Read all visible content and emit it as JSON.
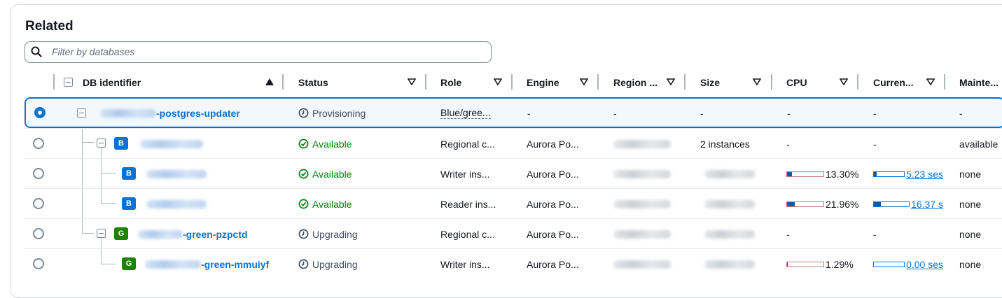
{
  "panel": {
    "title": "Related",
    "filter_placeholder": "Filter by databases"
  },
  "columns": [
    {
      "label": "DB identifier",
      "sort": "asc"
    },
    {
      "label": "Status"
    },
    {
      "label": "Role"
    },
    {
      "label": "Engine"
    },
    {
      "label": "Region ..."
    },
    {
      "label": "Size"
    },
    {
      "label": "CPU"
    },
    {
      "label": "Curren..."
    },
    {
      "label": "Mainte..."
    }
  ],
  "rows": [
    {
      "selected": true,
      "id_suffix": "-postgres-updater",
      "badge": "",
      "status": "Provisioning",
      "status_kind": "pending",
      "role": "Blue/gree...",
      "engine": "-",
      "region": "-",
      "size": "-",
      "cpu": "-",
      "conn": "-",
      "maint": "-"
    },
    {
      "selected": false,
      "id_suffix": "",
      "badge": "B",
      "status": "Available",
      "status_kind": "ok",
      "role": "Regional c...",
      "engine": "Aurora Po...",
      "region": "",
      "size": "2 instances",
      "cpu": "-",
      "conn": "-",
      "maint": "available"
    },
    {
      "selected": false,
      "id_suffix": "",
      "badge": "B",
      "status": "Available",
      "status_kind": "ok",
      "role": "Writer ins...",
      "engine": "Aurora Po...",
      "region": "",
      "size": "",
      "cpu_value": "13.30%",
      "cpu_fraction": 0.133,
      "conn_value": "5.23 ses",
      "conn_fraction": 0.1,
      "maint": "none"
    },
    {
      "selected": false,
      "id_suffix": "",
      "badge": "B",
      "status": "Available",
      "status_kind": "ok",
      "role": "Reader ins...",
      "engine": "Aurora Po...",
      "region": "",
      "size": "",
      "cpu_value": "21.96%",
      "cpu_fraction": 0.22,
      "conn_value": "16.37 s",
      "conn_fraction": 0.2,
      "maint": "none"
    },
    {
      "selected": false,
      "id_suffix": "-green-pzpctd",
      "badge": "G",
      "status": "Upgrading",
      "status_kind": "pending",
      "role": "Regional c...",
      "engine": "Aurora Po...",
      "region": "",
      "size": "",
      "cpu": "-",
      "conn": "-",
      "maint": "none"
    },
    {
      "selected": false,
      "id_suffix": "-green-mmuiyf",
      "badge": "G",
      "status": "Upgrading",
      "status_kind": "pending",
      "role": "Writer ins...",
      "engine": "Aurora Po...",
      "region": "",
      "size": "",
      "cpu_value": "1.29%",
      "cpu_fraction": 0.013,
      "conn_value": "0.00 ses",
      "conn_fraction": 0.0,
      "maint": "none"
    }
  ],
  "icons": {
    "search": "search-icon",
    "sort_asc": "sort-ascending-icon",
    "sort": "sort-icon",
    "ok": "check-circle-icon",
    "pending": "clock-icon",
    "collapse": "collapse-square-icon"
  },
  "colors": {
    "accent": "#0972d3",
    "success": "#037f0c",
    "blue_badge": "#0972d3",
    "green_badge": "#1d8102"
  }
}
